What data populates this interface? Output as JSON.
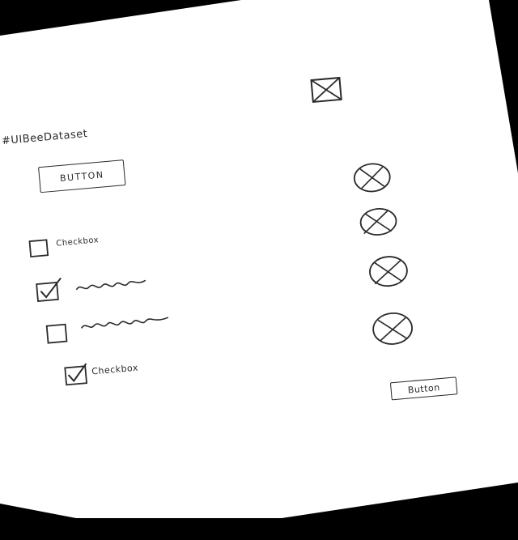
{
  "watermark": "#UIBeeDataset",
  "buttons": {
    "primary_label": "BUTTON",
    "secondary_label": "Button"
  },
  "checkboxes": [
    {
      "label": "Checkbox",
      "checked": false
    },
    {
      "label": "",
      "checked": true
    },
    {
      "label": "",
      "checked": false
    },
    {
      "label": "Checkbox",
      "checked": true
    }
  ],
  "icons": {
    "image_placeholder": "image-placeholder-icon",
    "radio_items": [
      "radio-x-icon",
      "radio-x-icon",
      "radio-x-icon",
      "radio-x-icon"
    ]
  },
  "colors": {
    "ink": "#2a2a2a",
    "paper": "#ffffff",
    "background": "#000000"
  }
}
